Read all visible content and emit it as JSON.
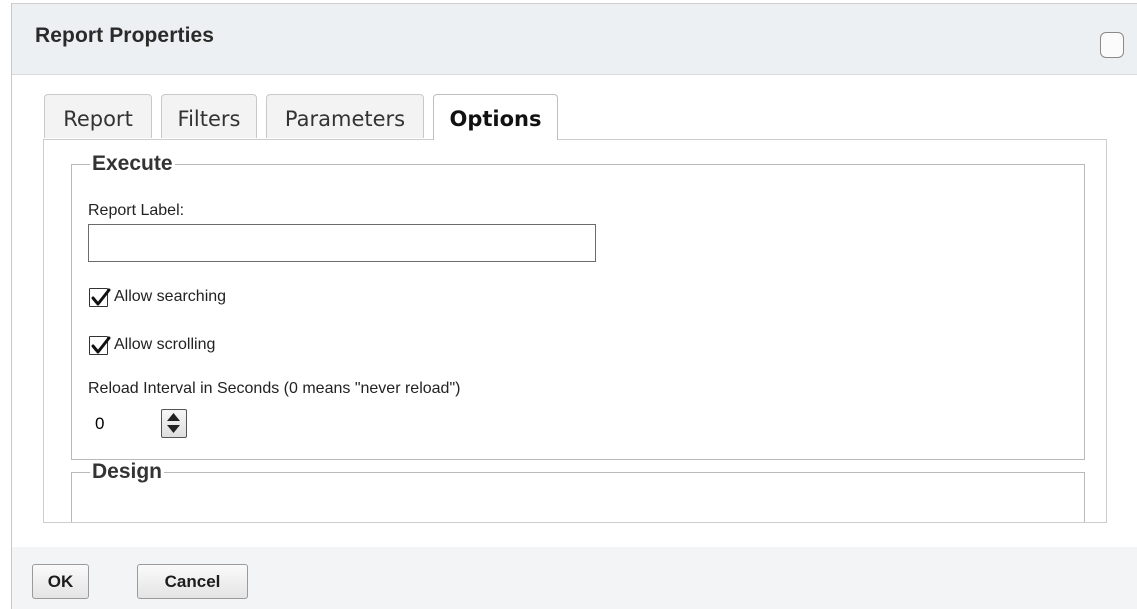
{
  "dialog": {
    "title": "Report Properties"
  },
  "tabs": [
    {
      "label": "Report",
      "active": false
    },
    {
      "label": "Filters",
      "active": false
    },
    {
      "label": "Parameters",
      "active": false
    },
    {
      "label": "Options",
      "active": true
    }
  ],
  "execute": {
    "legend": "Execute",
    "report_label": {
      "label": "Report Label:",
      "value": ""
    },
    "allow_searching": {
      "label": "Allow searching",
      "checked": true
    },
    "allow_scrolling": {
      "label": "Allow scrolling",
      "checked": true
    },
    "reload_interval": {
      "label": "Reload Interval in Seconds (0 means \"never reload\")",
      "value": "0"
    }
  },
  "design": {
    "legend": "Design"
  },
  "footer": {
    "ok_label": "OK",
    "cancel_label": "Cancel"
  },
  "icons": {
    "maximize": "maximize-icon",
    "checkmark": "checkmark-icon",
    "spinner": "up-down-arrows-icon"
  }
}
